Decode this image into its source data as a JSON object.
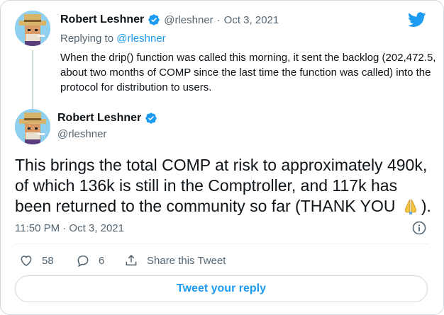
{
  "parent_tweet": {
    "author_name": "Robert Leshner",
    "handle": "@rleshner",
    "date_sep": "·",
    "date": "Oct 3, 2021",
    "replying_prefix": "Replying to",
    "replying_handle": "@rleshner",
    "text": "When the drip() function was called this morning, it sent the backlog (202,472.5, about two months of COMP since the last time the function was called) into the protocol for distribution to users."
  },
  "main_tweet": {
    "author_name": "Robert Leshner",
    "handle": "@rleshner",
    "text_before_emoji": "This brings the total COMP at risk to approximately 490k, of which 136k is still in the Comptroller, and 117k has been returned to the community so far (THANK YOU",
    "emoji": "folded-hands",
    "text_after_emoji": ").",
    "timestamp": "11:50 PM · Oct 3, 2021"
  },
  "actions": {
    "likes": "58",
    "replies": "6",
    "share_label": "Share this Tweet"
  },
  "reply_button_label": "Tweet your reply",
  "icons": {
    "brand": "twitter-bird-icon",
    "verified": "verified-badge-icon",
    "info": "info-icon",
    "like": "heart-icon",
    "reply": "reply-bubble-icon",
    "share": "share-icon"
  },
  "colors": {
    "accent": "#1d9bf0",
    "muted_text": "#536471",
    "border": "#cfd9de"
  }
}
